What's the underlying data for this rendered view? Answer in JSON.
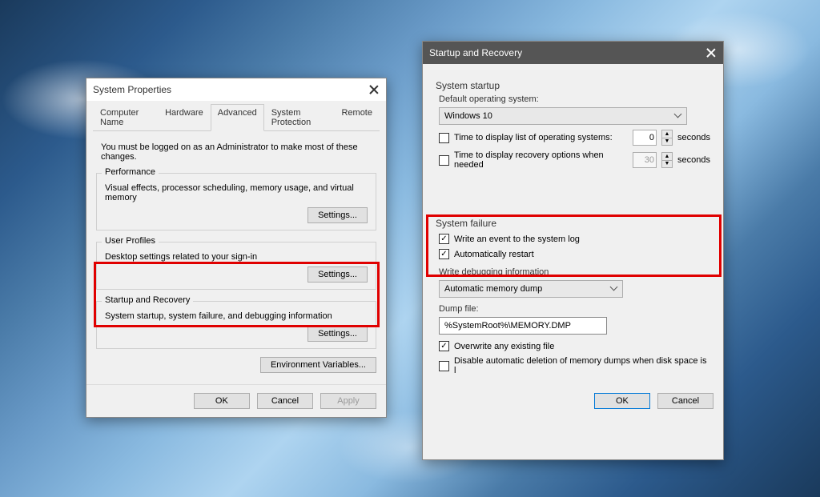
{
  "sysprops": {
    "title": "System Properties",
    "tabs": {
      "computer_name": "Computer Name",
      "hardware": "Hardware",
      "advanced": "Advanced",
      "system_protection": "System Protection",
      "remote": "Remote"
    },
    "admin_note": "You must be logged on as an Administrator to make most of these changes.",
    "performance": {
      "title": "Performance",
      "desc": "Visual effects, processor scheduling, memory usage, and virtual memory",
      "settings_btn": "Settings..."
    },
    "user_profiles": {
      "title": "User Profiles",
      "desc": "Desktop settings related to your sign-in",
      "settings_btn": "Settings..."
    },
    "startup_recovery": {
      "title": "Startup and Recovery",
      "desc": "System startup, system failure, and debugging information",
      "settings_btn": "Settings..."
    },
    "env_vars_btn": "Environment Variables...",
    "footer": {
      "ok": "OK",
      "cancel": "Cancel",
      "apply": "Apply"
    }
  },
  "recovery": {
    "title": "Startup and Recovery",
    "system_startup": {
      "heading": "System startup",
      "default_os_label": "Default operating system:",
      "default_os_value": "Windows 10",
      "time_os_list_label": "Time to display list of operating systems:",
      "time_os_list_value": "0",
      "time_recovery_label": "Time to display recovery options when needed",
      "time_recovery_value": "30",
      "seconds": "seconds"
    },
    "system_failure": {
      "heading": "System failure",
      "write_event_label": "Write an event to the system log",
      "auto_restart_label": "Automatically restart"
    },
    "debug": {
      "heading": "Write debugging information",
      "dump_type": "Automatic memory dump",
      "dump_file_label": "Dump file:",
      "dump_file_value": "%SystemRoot%\\MEMORY.DMP",
      "overwrite_label": "Overwrite any existing file",
      "disable_auto_delete_label": "Disable automatic deletion of memory dumps when disk space is l"
    },
    "footer": {
      "ok": "OK",
      "cancel": "Cancel"
    }
  }
}
